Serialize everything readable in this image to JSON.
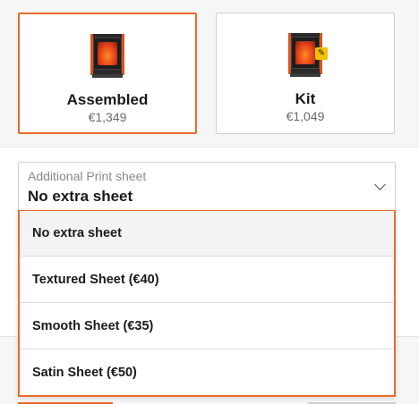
{
  "variants": [
    {
      "title": "Assembled",
      "price": "€1,349",
      "selected": true,
      "icon": "printer-assembled-icon"
    },
    {
      "title": "Kit",
      "price": "€1,049",
      "selected": false,
      "icon": "printer-kit-icon",
      "badge_icon": "wrench-badge-icon"
    }
  ],
  "print_sheet": {
    "label": "Additional Print sheet",
    "value": "No extra sheet",
    "options": [
      {
        "label": "No extra sheet",
        "active": true
      },
      {
        "label": "Textured Sheet (€40)",
        "active": false
      },
      {
        "label": "Smooth Sheet (€35)",
        "active": false
      },
      {
        "label": "Satin Sheet (€50)",
        "active": false
      }
    ]
  },
  "colors": {
    "accent": "#ea6a2a",
    "border": "#cfcfcf",
    "muted_text": "#6b6b6b"
  }
}
